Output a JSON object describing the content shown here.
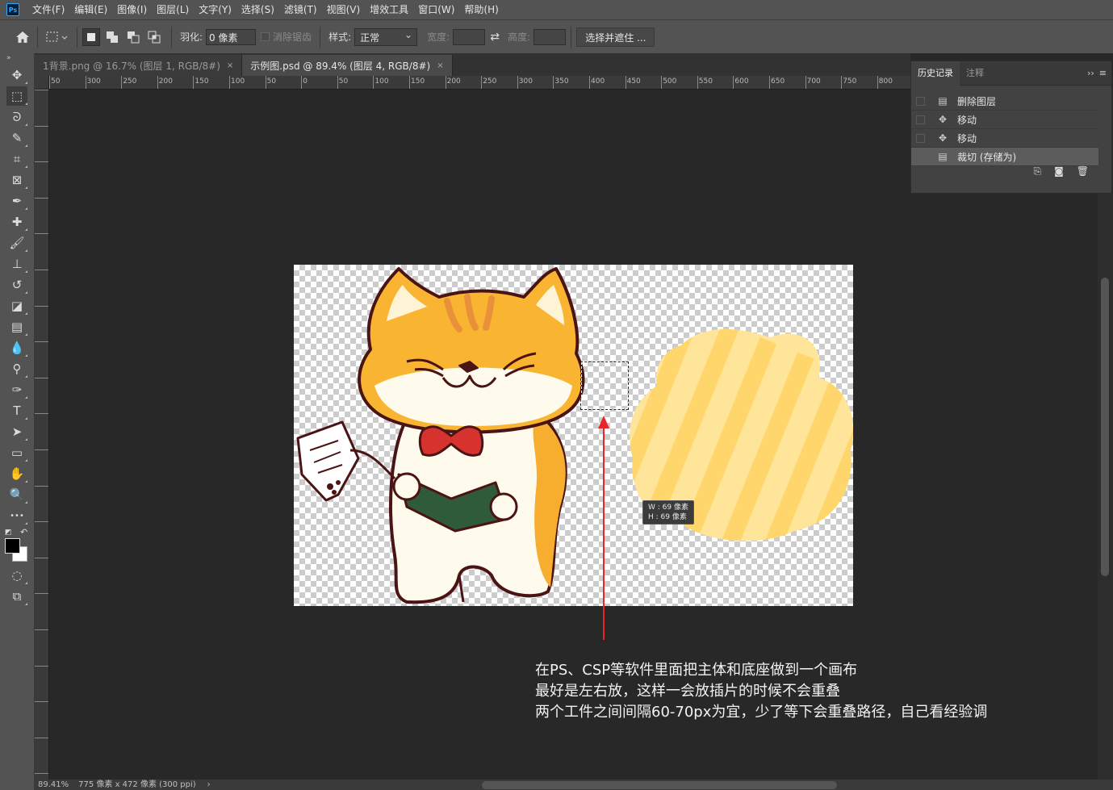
{
  "menubar": {
    "logo": "Ps",
    "items": [
      "文件(F)",
      "编辑(E)",
      "图像(I)",
      "图层(L)",
      "文字(Y)",
      "选择(S)",
      "滤镜(T)",
      "视图(V)",
      "增效工具",
      "窗口(W)",
      "帮助(H)"
    ]
  },
  "options": {
    "feather_label": "羽化:",
    "feather_value": "0 像素",
    "antialias_label": "消除锯齿",
    "style_label": "样式:",
    "style_value": "正常",
    "width_label": "宽度:",
    "height_label": "高度:",
    "select_mask_button": "选择并遮住 ..."
  },
  "tabs": [
    {
      "label": "1背景.png @ 16.7% (图层 1, RGB/8#)",
      "close": "×"
    },
    {
      "label": "示例图.psd @ 89.4% (图层 4, RGB/8#)",
      "close": "×"
    }
  ],
  "ruler_h": [
    "50",
    "300",
    "250",
    "200",
    "150",
    "100",
    "50",
    "0",
    "50",
    "100",
    "150",
    "200",
    "250",
    "300",
    "350",
    "400",
    "450",
    "500",
    "550",
    "600",
    "650",
    "700",
    "750",
    "800"
  ],
  "ruler_v": [
    "5",
    "0",
    "1",
    "0",
    "0",
    "1",
    "5",
    "0",
    "2",
    "0",
    "0",
    "2",
    "5",
    "0",
    "3",
    "0",
    "0"
  ],
  "tools": [
    {
      "name": "move-tool-icon",
      "glyph": "✥"
    },
    {
      "name": "marquee-tool-icon",
      "glyph": "⬚"
    },
    {
      "name": "lasso-tool-icon",
      "glyph": "ᘐ"
    },
    {
      "name": "magic-wand-tool-icon",
      "glyph": "✎"
    },
    {
      "name": "crop-tool-icon",
      "glyph": "⌗"
    },
    {
      "name": "frame-tool-icon",
      "glyph": "⊠"
    },
    {
      "name": "eyedropper-tool-icon",
      "glyph": "✒"
    },
    {
      "name": "healing-brush-tool-icon",
      "glyph": "✚"
    },
    {
      "name": "brush-tool-icon",
      "glyph": "🖌"
    },
    {
      "name": "clone-stamp-tool-icon",
      "glyph": "⊥"
    },
    {
      "name": "history-brush-tool-icon",
      "glyph": "↺"
    },
    {
      "name": "eraser-tool-icon",
      "glyph": "◪"
    },
    {
      "name": "gradient-tool-icon",
      "glyph": "▤"
    },
    {
      "name": "blur-tool-icon",
      "glyph": "💧"
    },
    {
      "name": "dodge-tool-icon",
      "glyph": "⚲"
    },
    {
      "name": "pen-tool-icon",
      "glyph": "✑"
    },
    {
      "name": "type-tool-icon",
      "glyph": "T"
    },
    {
      "name": "path-selection-tool-icon",
      "glyph": "➤"
    },
    {
      "name": "rectangle-tool-icon",
      "glyph": "▭"
    },
    {
      "name": "hand-tool-icon",
      "glyph": "✋"
    },
    {
      "name": "zoom-tool-icon",
      "glyph": "🔍"
    },
    {
      "name": "more-tools-icon",
      "glyph": "•••"
    }
  ],
  "canvas": {
    "tooltip_w": "W :  69 像素",
    "tooltip_h": "H :  69 像素"
  },
  "annotation": {
    "line1": "在PS、CSP等软件里面把主体和底座做到一个画布",
    "line2": "最好是左右放，这样一会放插片的时候不会重叠",
    "line3": "两个工件之间间隔60-70px为宜，少了等下会重叠路径，自己看经验调"
  },
  "history_panel": {
    "tab_history": "历史记录",
    "tab_notes": "注释",
    "rows": [
      {
        "label": "删除图层",
        "icon": "document-icon"
      },
      {
        "label": "移动",
        "icon": "move-icon"
      },
      {
        "label": "移动",
        "icon": "move-icon"
      },
      {
        "label": "裁切 (存储为)",
        "icon": "document-icon"
      }
    ]
  },
  "status": {
    "zoom": "89.41%",
    "doc_size": "775 像素 x 472 像素 (300 ppi)",
    "arrow": "›"
  },
  "colors": {
    "accent": "#31a8ff",
    "arrow_red": "#e8262a",
    "cat_orange": "#f5a623",
    "paw_yellow": "#ffd666"
  }
}
